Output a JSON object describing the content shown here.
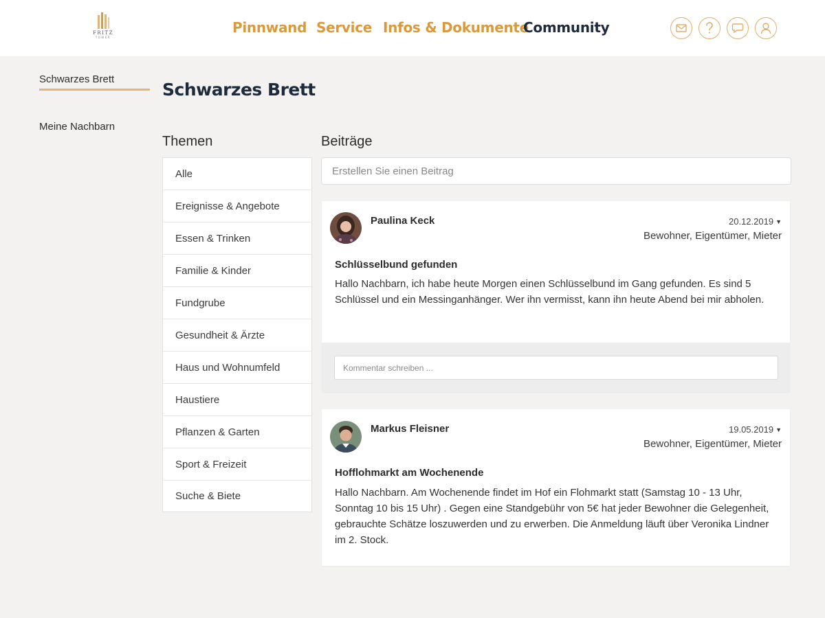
{
  "header": {
    "logo": {
      "text": "FRITZ",
      "sub": "TOWER"
    },
    "nav": [
      {
        "label": "Pinnwand"
      },
      {
        "label": "Service"
      },
      {
        "label": "Infos & Dokumente"
      },
      {
        "label": "Community"
      }
    ],
    "icons": [
      "mail-icon",
      "help-icon",
      "chat-icon",
      "user-icon"
    ],
    "accent_color": "#d99a3e",
    "active_color": "#1f2a3a"
  },
  "sidebar": {
    "items": [
      {
        "label": "Schwarzes Brett"
      },
      {
        "label": "Meine Nachbarn"
      }
    ]
  },
  "page": {
    "title": "Schwarzes Brett",
    "topics_heading": "Themen",
    "posts_heading": "Beiträge",
    "create_placeholder": "Erstellen Sie einen Beitrag"
  },
  "topics": [
    {
      "label": "Alle"
    },
    {
      "label": "Ereignisse & Angebote"
    },
    {
      "label": "Essen & Trinken"
    },
    {
      "label": "Familie & Kinder"
    },
    {
      "label": "Fundgrube"
    },
    {
      "label": "Gesundheit & Ärzte"
    },
    {
      "label": "Haus und Wohnumfeld"
    },
    {
      "label": "Haustiere"
    },
    {
      "label": "Pflanzen & Garten"
    },
    {
      "label": "Sport & Freizeit"
    },
    {
      "label": "Suche & Biete"
    }
  ],
  "posts": [
    {
      "author": "Paulina Keck",
      "date": "20.12.2019",
      "audience": "Bewohner, Eigentümer, Mieter",
      "title": "Schlüsselbund gefunden",
      "body": "Hallo Nachbarn, ich habe heute Morgen einen Schlüsselbund im Gang gefunden. Es sind 5 Schlüssel und ein Messinganhänger. Wer ihn vermisst, kann ihn heute Abend bei mir abholen.",
      "comment_placeholder": "Kommentar schreiben ..."
    },
    {
      "author": "Markus Fleisner",
      "date": "19.05.2019",
      "audience": "Bewohner, Eigentümer, Mieter",
      "title": "Hofflohmarkt am Wochenende",
      "body": "Hallo Nachbarn. Am Wochenende findet im Hof ein Flohmarkt statt (Samstag 10 - 13 Uhr, Sonntag 10 bis 15 Uhr) . Gegen eine Standgebühr von 5€ hat jeder Bewohner die Gelegenheit, gebrauchte Schätze loszuwerden und zu erwerben. Die Anmeldung läuft über Veronika Lindner im 2. Stock."
    }
  ]
}
